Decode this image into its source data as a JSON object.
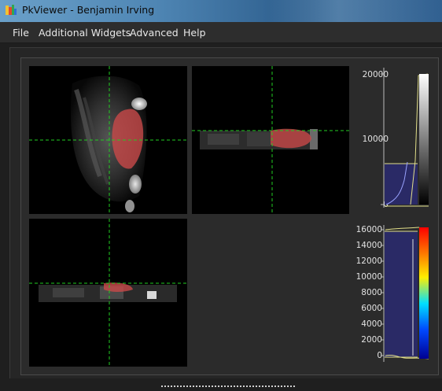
{
  "window": {
    "title": "PkViewer - Benjamin Irving",
    "icon": "pkviewer-app-icon"
  },
  "menu": {
    "items": [
      "File",
      "Additional Widgets",
      "Advanced",
      "Help"
    ]
  },
  "views": {
    "axial": {
      "name": "axial-view",
      "crosshair_color": "#22cc22",
      "overlay_color": "#c84848"
    },
    "coronal": {
      "name": "coronal-view",
      "crosshair_color": "#22cc22",
      "overlay_color": "#c84848"
    },
    "sagittal": {
      "name": "sagittal-view",
      "crosshair_color": "#22cc22",
      "overlay_color": "#c84848"
    }
  },
  "histograms": {
    "top": {
      "ticks": [
        "20000",
        "10000",
        "0"
      ],
      "lut": "grayscale",
      "region_color": "#2a2a66"
    },
    "bottom": {
      "ticks": [
        "16000",
        "14000",
        "12000",
        "10000",
        "8000",
        "6000",
        "4000",
        "2000",
        "0"
      ],
      "lut": "jet",
      "region_color": "#2a2a66"
    }
  }
}
